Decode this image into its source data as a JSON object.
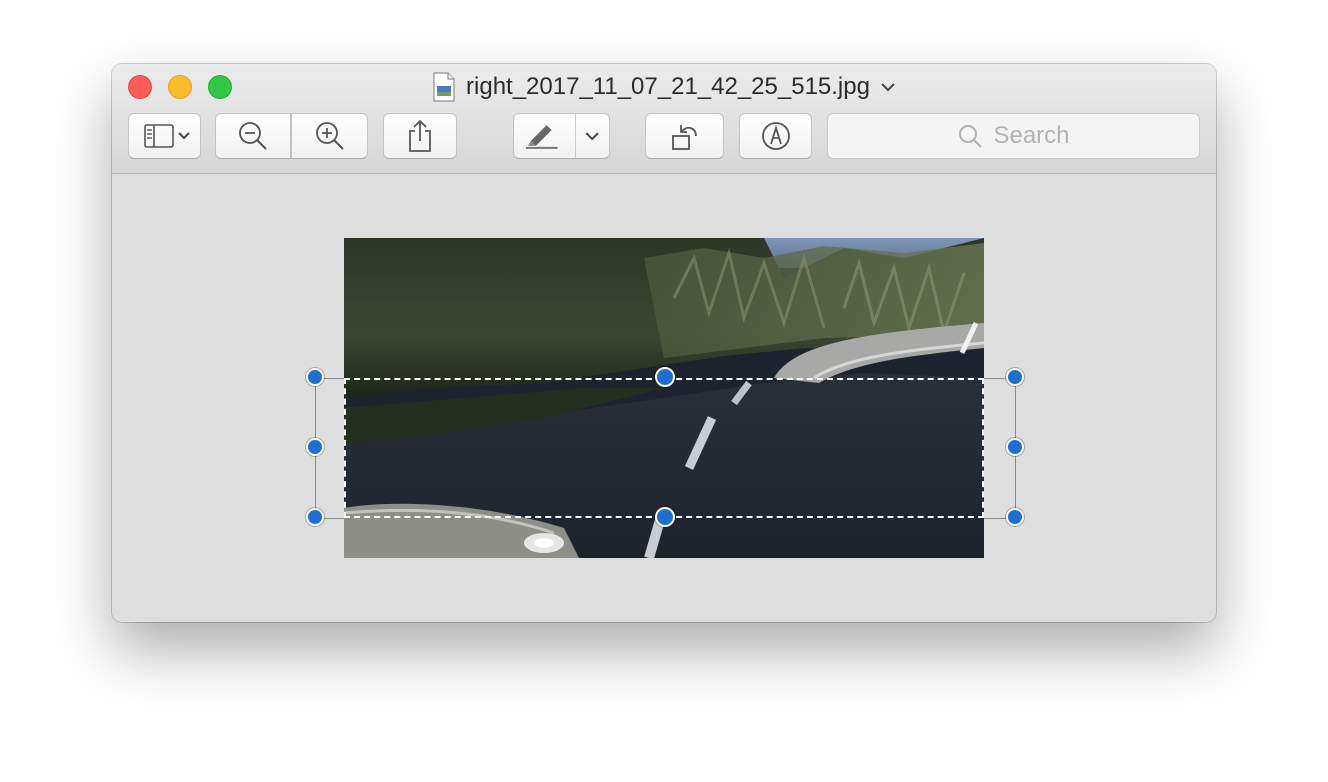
{
  "window": {
    "title": "right_2017_11_07_21_42_25_515.jpg",
    "traffic_lights": {
      "close": "#fc5f57",
      "minimize": "#fdbc2e",
      "zoom": "#33c748"
    }
  },
  "toolbar": {
    "buttons": [
      {
        "name": "sidebar-view-button",
        "icon": "sidebar-icon"
      },
      {
        "name": "zoom-out-button",
        "icon": "zoom-out-icon"
      },
      {
        "name": "zoom-in-button",
        "icon": "zoom-in-icon"
      },
      {
        "name": "share-button",
        "icon": "share-icon"
      },
      {
        "name": "highlight-button",
        "icon": "highlighter-icon"
      },
      {
        "name": "rotate-button",
        "icon": "rotate-left-icon"
      },
      {
        "name": "markup-button",
        "icon": "markup-pen-icon"
      }
    ],
    "search": {
      "placeholder": "Search",
      "icon": "search-icon"
    }
  },
  "canvas": {
    "image_subject": "road-scene-photo",
    "selection": {
      "handle_color": "#1f6fd1",
      "border_style": "dashed"
    }
  }
}
